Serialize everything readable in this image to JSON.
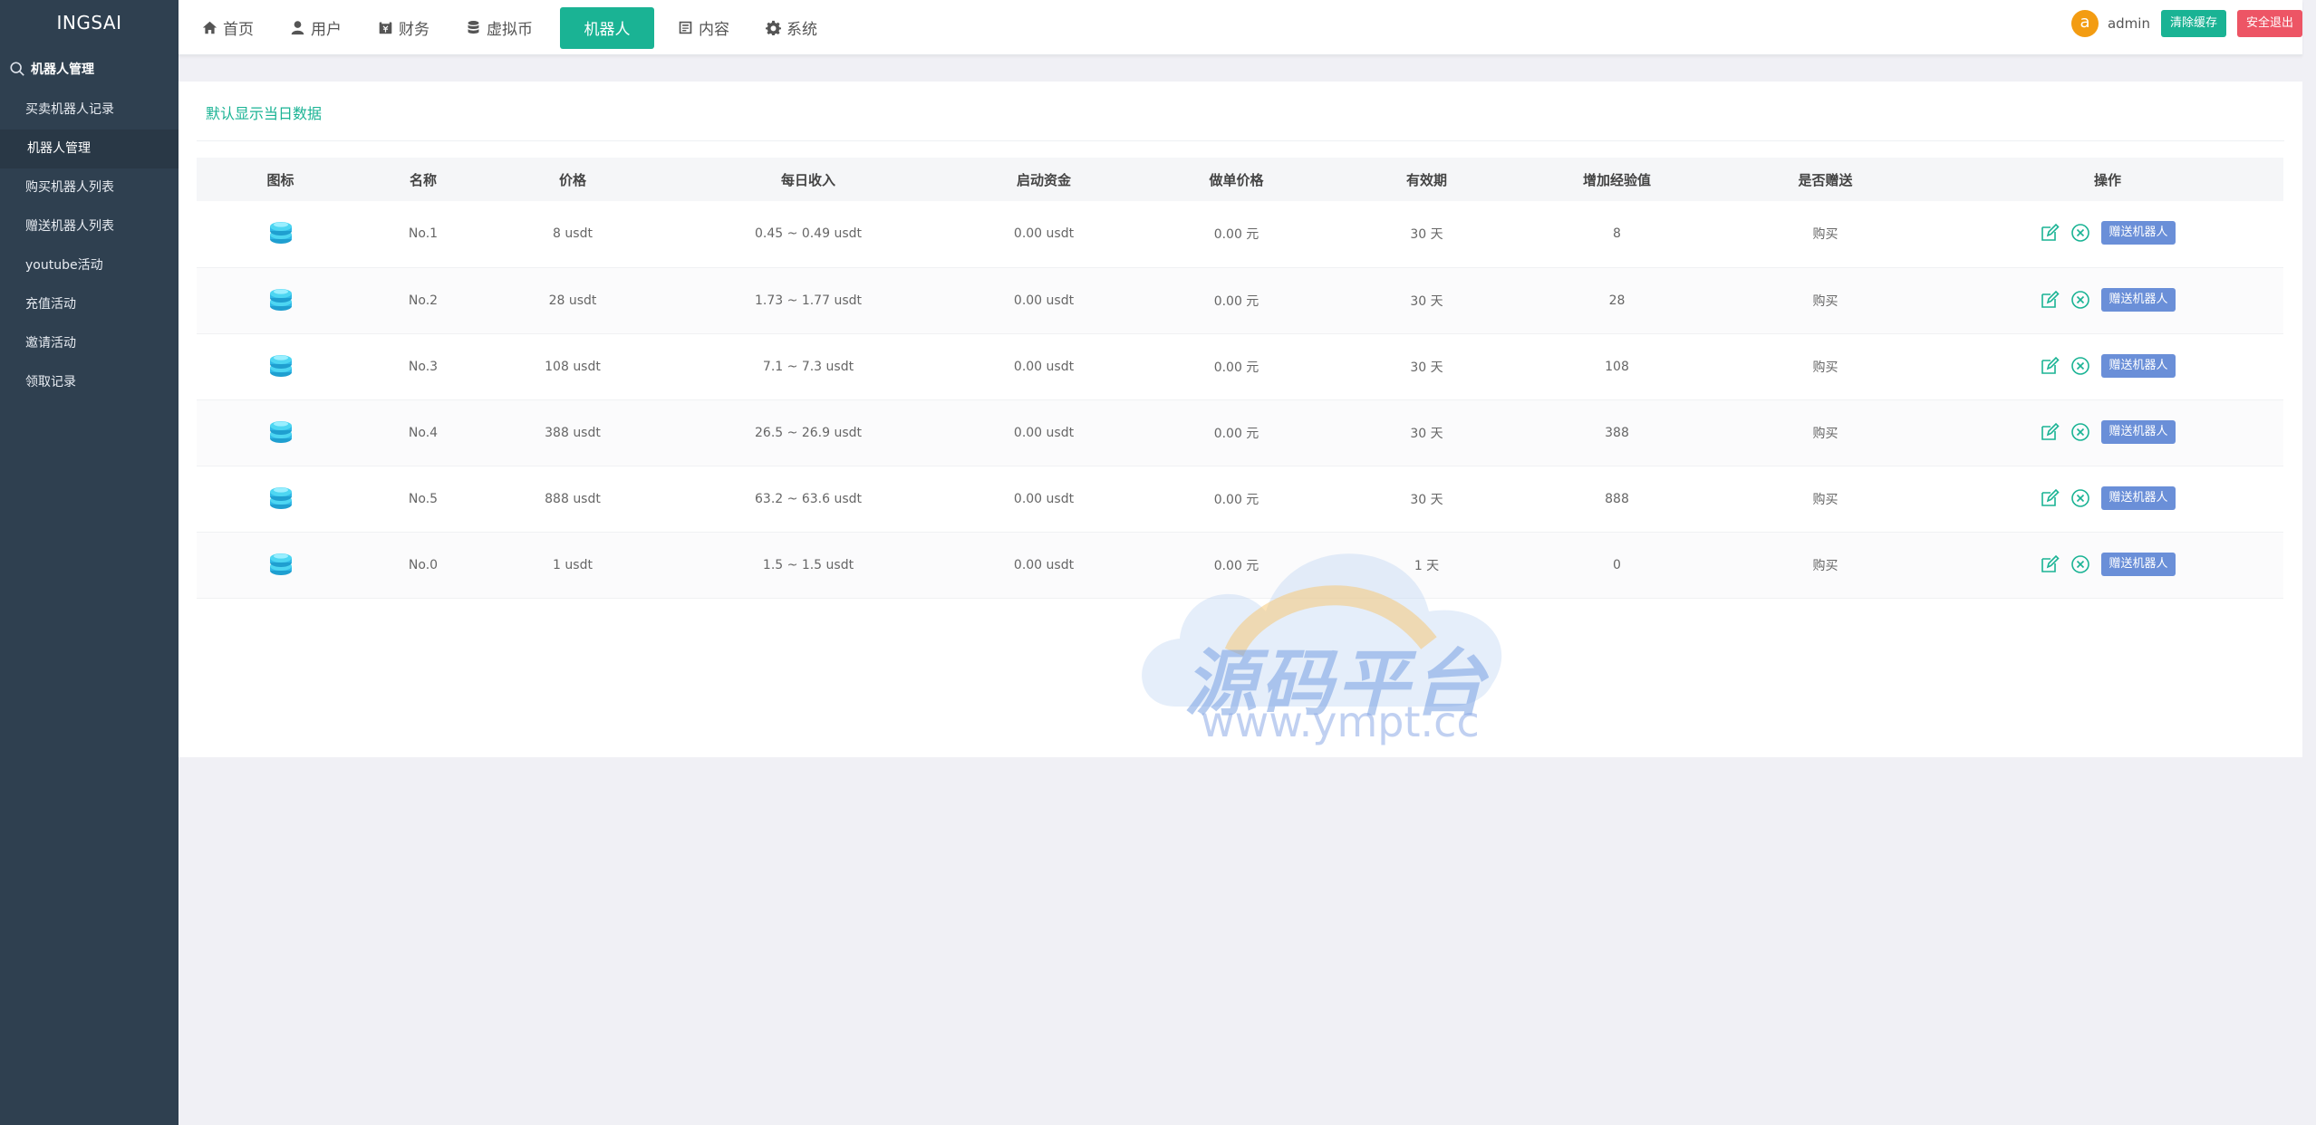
{
  "sidebar": {
    "brand": "INGSAI",
    "group_label": "机器人管理",
    "items": [
      {
        "label": "买卖机器人记录",
        "active": false
      },
      {
        "label": "机器人管理",
        "active": true
      },
      {
        "label": "购买机器人列表",
        "active": false
      },
      {
        "label": "赠送机器人列表",
        "active": false
      },
      {
        "label": "youtube活动",
        "active": false
      },
      {
        "label": "充值活动",
        "active": false
      },
      {
        "label": "邀请活动",
        "active": false
      },
      {
        "label": "领取记录",
        "active": false
      }
    ]
  },
  "nav": {
    "items": [
      {
        "label": "首页",
        "icon": "home-icon"
      },
      {
        "label": "用户",
        "icon": "user-icon"
      },
      {
        "label": "财务",
        "icon": "finance-icon"
      },
      {
        "label": "虚拟币",
        "icon": "database-icon"
      },
      {
        "label": "机器人",
        "icon": "",
        "active": true
      },
      {
        "label": "内容",
        "icon": "content-icon"
      },
      {
        "label": "系统",
        "icon": "gear-icon"
      }
    ]
  },
  "header": {
    "avatar_letter": "a",
    "username": "admin",
    "clear_cache_label": "清除缓存",
    "logout_label": "安全退出"
  },
  "main": {
    "title": "默认显示当日数据",
    "columns": [
      "图标",
      "名称",
      "价格",
      "每日收入",
      "启动资金",
      "做单价格",
      "有效期",
      "增加经验值",
      "是否赠送",
      "操作"
    ],
    "rows": [
      {
        "name": "No.1",
        "price": "8 usdt",
        "daily": "0.45 ~ 0.49 usdt",
        "start": "0.00 usdt",
        "order_price": "0.00 元",
        "validity": "30 天",
        "exp": "8",
        "gift": "购买"
      },
      {
        "name": "No.2",
        "price": "28 usdt",
        "daily": "1.73 ~ 1.77 usdt",
        "start": "0.00 usdt",
        "order_price": "0.00 元",
        "validity": "30 天",
        "exp": "28",
        "gift": "购买"
      },
      {
        "name": "No.3",
        "price": "108 usdt",
        "daily": "7.1 ~ 7.3 usdt",
        "start": "0.00 usdt",
        "order_price": "0.00 元",
        "validity": "30 天",
        "exp": "108",
        "gift": "购买"
      },
      {
        "name": "No.4",
        "price": "388 usdt",
        "daily": "26.5 ~ 26.9 usdt",
        "start": "0.00 usdt",
        "order_price": "0.00 元",
        "validity": "30 天",
        "exp": "388",
        "gift": "购买"
      },
      {
        "name": "No.5",
        "price": "888 usdt",
        "daily": "63.2 ~ 63.6 usdt",
        "start": "0.00 usdt",
        "order_price": "0.00 元",
        "validity": "30 天",
        "exp": "888",
        "gift": "购买"
      },
      {
        "name": "No.0",
        "price": "1 usdt",
        "daily": "1.5 ~ 1.5 usdt",
        "start": "0.00 usdt",
        "order_price": "0.00 元",
        "validity": "1 天",
        "exp": "0",
        "gift": "购买"
      }
    ],
    "gift_button_label": "赠送机器人"
  },
  "watermark": {
    "cn": "源码平台",
    "url": "www.ympt.cc"
  },
  "colors": {
    "sidebar_bg": "#2f4050",
    "accent": "#1ab394",
    "danger": "#ed5565",
    "gift_button": "#6a8fd8"
  }
}
